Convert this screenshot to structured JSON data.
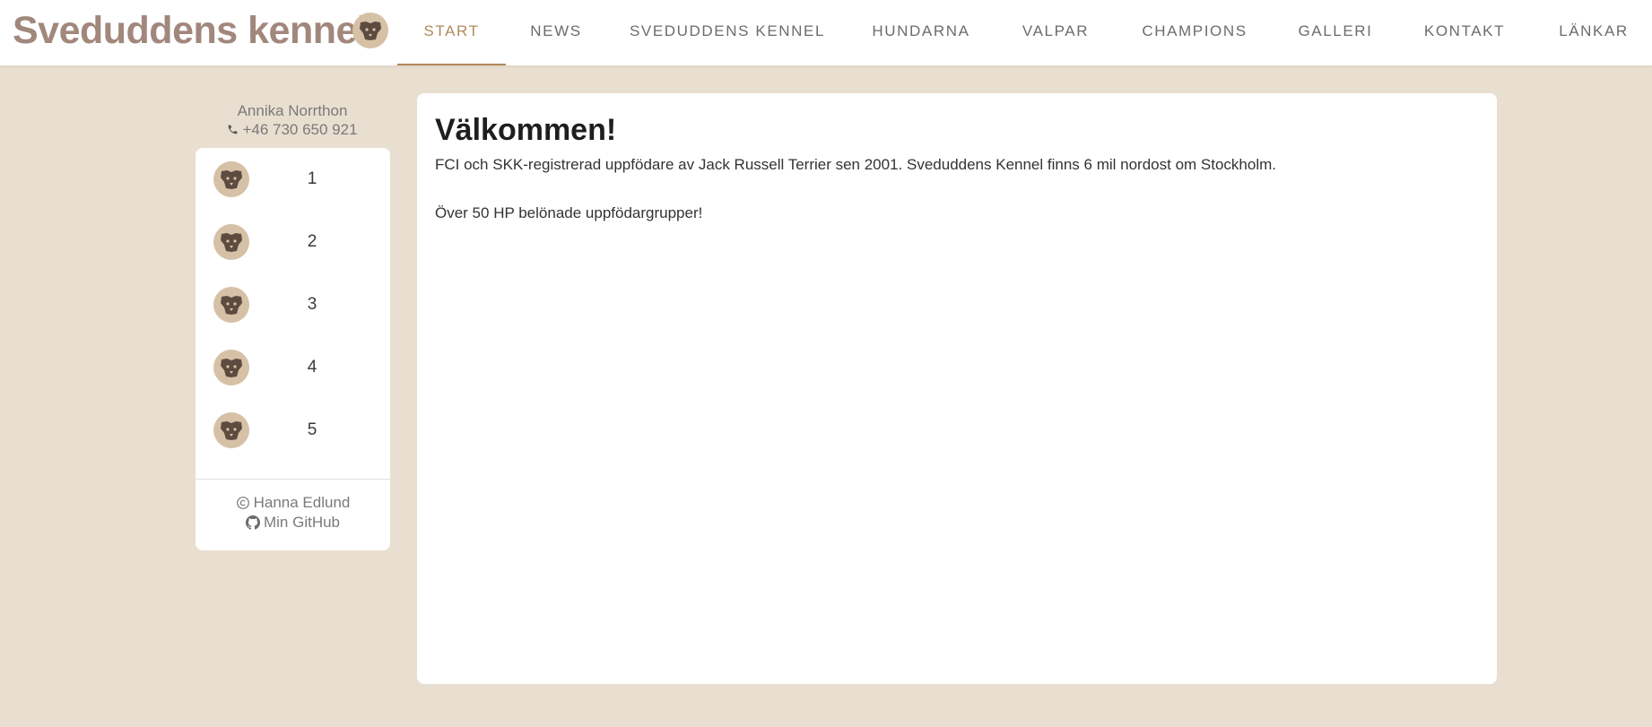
{
  "header": {
    "title": "Sveduddens kennel",
    "logo_icon": "dog-face-icon",
    "nav": [
      {
        "label": "START",
        "active": true
      },
      {
        "label": "NEWS",
        "active": false
      },
      {
        "label": "SVEDUDDENS KENNEL",
        "active": false
      },
      {
        "label": "HUNDARNA",
        "active": false
      },
      {
        "label": "VALPAR",
        "active": false
      },
      {
        "label": "CHAMPIONS",
        "active": false
      },
      {
        "label": "GALLERI",
        "active": false
      },
      {
        "label": "KONTAKT",
        "active": false
      },
      {
        "label": "LÄNKAR",
        "active": false
      }
    ]
  },
  "sidebar": {
    "contact_name": "Annika Norrthon",
    "contact_phone": "+46 730 650 921",
    "phone_icon": "phone-icon",
    "items": [
      {
        "label": "1",
        "icon": "dog-face-icon"
      },
      {
        "label": "2",
        "icon": "dog-face-icon"
      },
      {
        "label": "3",
        "icon": "dog-face-icon"
      },
      {
        "label": "4",
        "icon": "dog-face-icon"
      },
      {
        "label": "5",
        "icon": "dog-face-icon"
      }
    ],
    "footer": {
      "copyright_name": "Hanna Edlund",
      "github_label": "Min GitHub",
      "copyright_icon": "copyright-icon",
      "github_icon": "github-icon"
    }
  },
  "main": {
    "heading": "Välkommen!",
    "paragraphs": [
      "FCI och SKK-registrerad uppfödare av Jack Russell Terrier sen 2001. Sveduddens Kennel finns 6 mil nordost om Stockholm.",
      "Över 50 HP belönade uppfödargrupper!"
    ]
  },
  "colors": {
    "page_background": "#e9dfd0",
    "title": "#a1877c",
    "accent": "#b08a5b",
    "avatar_background": "#d6c1a6",
    "icon": "#5e4b40"
  }
}
